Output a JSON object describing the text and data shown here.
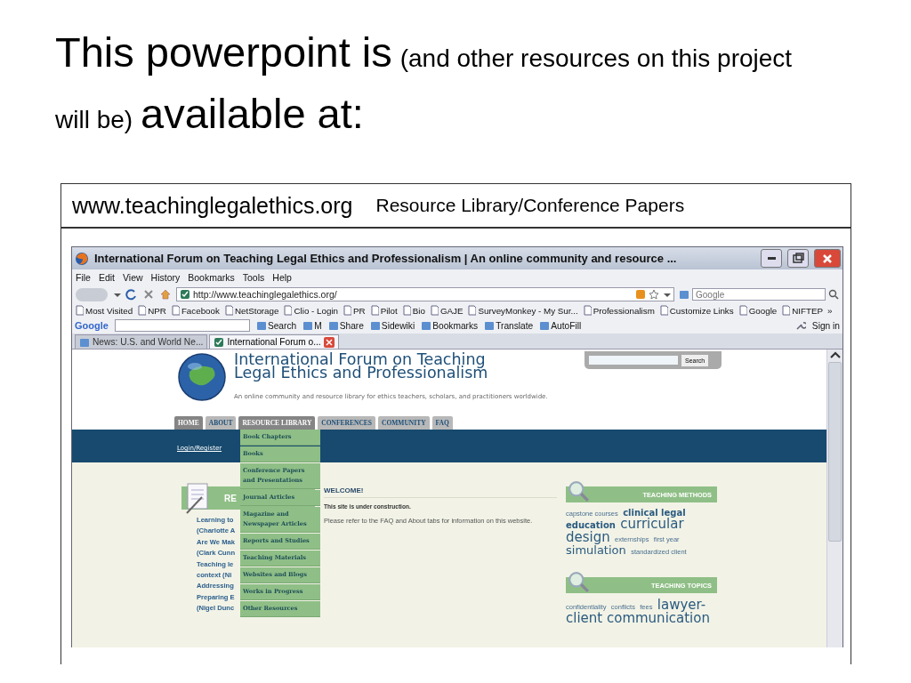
{
  "slide": {
    "title_parts": [
      {
        "text": "This powerpoint is",
        "kind": "large"
      },
      {
        "text": "(and other resources on this project will be)",
        "kind": "small"
      },
      {
        "text": "available at:",
        "kind": "large"
      }
    ],
    "site": "www.teachinglegalethics.org",
    "path": "Resource Library/Conference Papers"
  },
  "browser": {
    "title": "International Forum on Teaching Legal Ethics and Professionalism | An online community and resource ...",
    "menu": [
      "File",
      "Edit",
      "View",
      "History",
      "Bookmarks",
      "Tools",
      "Help"
    ],
    "address": "http://www.teachinglegalethics.org/",
    "search_placeholder": "Google",
    "bookmarks": [
      "Most Visited",
      "NPR",
      "Facebook",
      "NetStorage",
      "Clio - Login",
      "PR",
      "Pilot",
      "Bio",
      "GAJE",
      "SurveyMonkey - My Sur...",
      "Professionalism",
      "Customize Links",
      "Google",
      "NIFTEP"
    ],
    "bookmarks_more": "»",
    "google_toolbar": {
      "logo": "Google",
      "items": [
        "Search",
        "M",
        "Share",
        "Sidewiki",
        "Bookmarks",
        "Translate",
        "AutoFill"
      ],
      "sign_in": "Sign in"
    },
    "tabs": [
      {
        "label": "News: U.S. and World Ne...",
        "selected": false
      },
      {
        "label": "International Forum o...",
        "selected": true
      }
    ]
  },
  "page": {
    "site_title_lines": [
      "International Forum on Teaching",
      "Legal Ethics and Professionalism"
    ],
    "tagline": "An online community and resource library for ethics teachers, scholars, and practitioners worldwide.",
    "search_button": "Search",
    "nav": [
      {
        "label": "HOME",
        "active": true
      },
      {
        "label": "ABOUT",
        "active": false
      },
      {
        "label": "RESOURCE LIBRARY",
        "active": true
      },
      {
        "label": "CONFERENCES",
        "active": false
      },
      {
        "label": "COMMUNITY",
        "active": false
      },
      {
        "label": "FAQ",
        "active": false
      }
    ],
    "login": "Login/Register",
    "dropdown": [
      "Book Chapters",
      "Books",
      "Conference Papers and Presentations",
      "Journal Articles",
      "Magazine and Newspaper Articles",
      "Reports and Studies",
      "Teaching Materials",
      "Websites and Blogs",
      "Works in Progress",
      "Other Resources"
    ],
    "left_panel": {
      "title": "RE",
      "lines": [
        "Learning to",
        "(Charlotte A",
        "Are We Mak",
        "(Clark Cunn",
        "Teaching le",
        "context  (Ni",
        "Addressing",
        "Preparing E",
        "(Nigel Dunc"
      ]
    },
    "welcome": {
      "title": "WELCOME!",
      "lead": "This site is under construction.",
      "body": "Please refer to the FAQ and About tabs for information on this website."
    },
    "panels": [
      {
        "title": "TEACHING METHODS",
        "tags": [
          {
            "text": "capstone courses",
            "kind": "small"
          },
          {
            "text": "clinical legal education",
            "kind": "medium"
          },
          {
            "text": "curricular design",
            "kind": "xlarge"
          },
          {
            "text": "externships",
            "kind": "small"
          },
          {
            "text": "first year",
            "kind": "small"
          },
          {
            "text": "simulation",
            "kind": "large"
          },
          {
            "text": "standardized client",
            "kind": "small"
          }
        ]
      },
      {
        "title": "TEACHING TOPICS",
        "tags": [
          {
            "text": "confidentiality",
            "kind": "small"
          },
          {
            "text": "conflicts",
            "kind": "small"
          },
          {
            "text": "fees",
            "kind": "small"
          },
          {
            "text": "lawyer-client communication",
            "kind": "xlarge"
          }
        ]
      }
    ]
  }
}
